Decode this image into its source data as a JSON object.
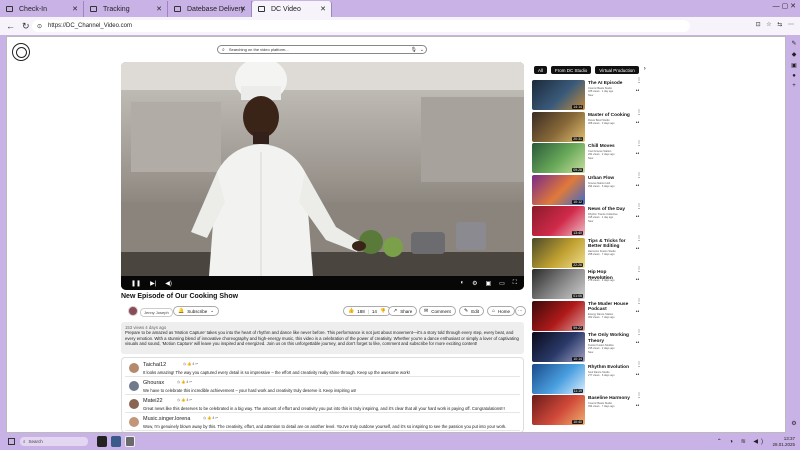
{
  "browser": {
    "tabs": [
      {
        "label": "Check-In",
        "active": false
      },
      {
        "label": "Tracking",
        "active": false
      },
      {
        "label": "Datebase Delivery",
        "active": false
      },
      {
        "label": "DC Video",
        "active": true
      }
    ],
    "url": "https://DC_Channel_Video.com"
  },
  "search": {
    "placeholder": "Searching on the video platform..."
  },
  "player": {
    "controls": [
      "play-pause-icon",
      "skip-next-icon",
      "volume-icon",
      "autoplay-toggle-icon",
      "settings-icon",
      "miniplayer-icon",
      "theater-icon",
      "fullscreen-icon"
    ]
  },
  "video": {
    "title": "New Episode of Our Cooking Show",
    "channel": "Jenny Joseph",
    "subscribe_label": "Subscribe",
    "likes": "188",
    "dislikes": "14",
    "share_label": "Share",
    "comment_label": "Comment",
    "edit_label": "Edit",
    "home_label": "Home",
    "meta": "153 views  4 days ago",
    "description": "Prepare to be amazed as 'Motion Capture' takes you into the heart of rhythm and dance like never before. This performance is not just about movement—it's a story told through every step, every beat, and every emotion. With a stunning blend of innovative choreography and high-energy music, this video is a celebration of the power of creativity. Whether you're a dance enthusiast or simply a lover of captivating visuals and sound, 'Motion Capture' will leave you inspired and energized. Join us on this unforgettable journey, and don't forget to like, comment and subscribe for more exciting content!"
  },
  "comments": [
    {
      "user": "Taichai12",
      "text": "It looks amazing! The way you captured every detail is so impressive – the effort and creativity really shine through. Keep up the awesome work!",
      "avatar_color": "#b48a6e"
    },
    {
      "user": "Ghourax",
      "text": "We have to celebrate this incredible achievement – your hard work and creativity truly deserve it. Keep inspiring us!",
      "avatar_color": "#6f7a8a"
    },
    {
      "user": "Matei22",
      "text": "Great news like this deserves to be celebrated in a big way. The amount of effort and creativity you put into this is truly inspiring, and it's clear that all your hard work is paying off. Congratulations!!!",
      "avatar_color": "#8a6552"
    },
    {
      "user": "Music.singer.lorena",
      "text": "Wow, I'm genuinely blown away by this. The creativity, effort, and attention to detail are on another level. You've truly outdone yourself, and it's so inspiring to see the passion you put into your work.",
      "avatar_color": "#c2967a"
    }
  ],
  "filters": [
    "All",
    "From DC Studio",
    "Virtual Production"
  ],
  "recommendations": [
    {
      "title": "The AI Episode",
      "channel": "Cosmic Beats Studio",
      "views": "325 views · 1 day ago",
      "badge": "New",
      "duration": "14:14",
      "colors": [
        "#1c2a3a",
        "#3a5a7a",
        "#c48a3a"
      ]
    },
    {
      "title": "Master of Cooking",
      "channel": "Flavor Bowl Studio",
      "views": "368 views · 3 days ago",
      "badge": "",
      "duration": "20:31",
      "colors": [
        "#3a2c22",
        "#8a6a3a",
        "#e0c070"
      ]
    },
    {
      "title": "Chill Moves",
      "channel": "Cool Groove Station",
      "views": "291 views · 2 days ago",
      "badge": "New",
      "duration": "09:26",
      "colors": [
        "#2a5a3a",
        "#6aaa5a",
        "#c8e0a0"
      ]
    },
    {
      "title": "Urban Flow",
      "channel": "Groove Nation Hub",
      "views": "294 views · 6 days ago",
      "badge": "",
      "duration": "10:12",
      "colors": [
        "#7a2a8a",
        "#e07a3a",
        "#3a6ad0"
      ]
    },
    {
      "title": "News of the Day",
      "channel": "Rhythm Trance Collective",
      "views": "315 views · 1 day ago",
      "badge": "New",
      "duration": "13:40",
      "colors": [
        "#8a1a2a",
        "#d02a4a",
        "#f0c0c8"
      ]
    },
    {
      "title": "Tips & Tricks for Better Editing",
      "channel": "Harmonic Fusion Studio",
      "views": "258 views · 7 days ago",
      "badge": "",
      "duration": "22:26",
      "colors": [
        "#4a4a2a",
        "#c0a030",
        "#f0e090"
      ]
    },
    {
      "title": "Hip Hop Revolution",
      "channel": "Dance Flair Studio",
      "views": "278 views · 4 days ago",
      "badge": "",
      "duration": "01:06",
      "colors": [
        "#2a2a2a",
        "#8a8a8a",
        "#d0d0d0"
      ]
    },
    {
      "title": "The Muder House Podcast",
      "channel": "Energy Dance Station",
      "views": "362 views · 7 days ago",
      "badge": "",
      "duration": "59:22",
      "colors": [
        "#3a0a0a",
        "#b01a1a",
        "#e0a0a0"
      ]
    },
    {
      "title": "The Only Working Theory",
      "channel": "Fusion Fusion Studios",
      "views": "235 views · 2 days ago",
      "badge": "New",
      "duration": "10:14",
      "colors": [
        "#0a0a1a",
        "#2a3a6a",
        "#a0a0c0"
      ]
    },
    {
      "title": "Rhythm Evolution",
      "channel": "Soul Dance Studio",
      "views": "277 views · 6 days ago",
      "badge": "",
      "duration": "11:19",
      "colors": [
        "#1a4a8a",
        "#4aa0e0",
        "#e0f0ff"
      ]
    },
    {
      "title": "Baseline Harmony",
      "channel": "Cosmic Beats Studio",
      "views": "394 views · 7 days ago",
      "badge": "",
      "duration": "10:40",
      "colors": [
        "#6a1a1a",
        "#d04a3a",
        "#f0b070"
      ]
    }
  ],
  "taskbar": {
    "search_placeholder": "Search",
    "time": "13:37",
    "date": "28.01.2025"
  }
}
